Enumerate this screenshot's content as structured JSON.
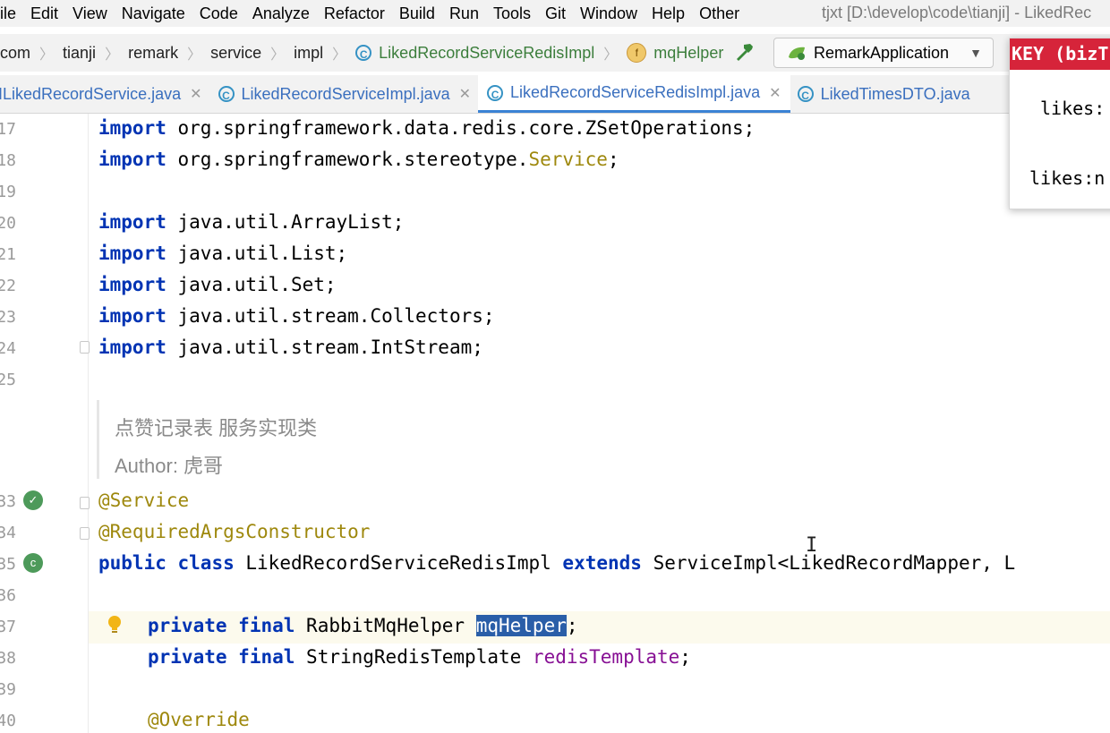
{
  "menu": {
    "items": [
      "ile",
      "Edit",
      "View",
      "Navigate",
      "Code",
      "Analyze",
      "Refactor",
      "Build",
      "Run",
      "Tools",
      "Git",
      "Window",
      "Help",
      "Other"
    ],
    "window_title": "tjxt [D:\\develop\\code\\tianji] - LikedRec"
  },
  "navbar": {
    "crumbs": [
      "com",
      "tianji",
      "remark",
      "service",
      "impl"
    ],
    "class_crumb": "LikedRecordServiceRedisImpl",
    "field_crumb": "mqHelper",
    "run_config": "RemarkApplication"
  },
  "tabs": [
    {
      "label": "ILikedRecordService.java",
      "closable": true,
      "active": false
    },
    {
      "label": "LikedRecordServiceImpl.java",
      "closable": true,
      "active": false
    },
    {
      "label": "LikedRecordServiceRedisImpl.java",
      "closable": true,
      "active": true
    },
    {
      "label": "LikedTimesDTO.java",
      "closable": false,
      "active": false
    }
  ],
  "editor": {
    "line_numbers": [
      "17",
      "18",
      "19",
      "20",
      "21",
      "22",
      "23",
      "24",
      "25",
      "33",
      "34",
      "35",
      "36",
      "37",
      "38",
      "39",
      "40"
    ],
    "imports": [
      "org.springframework.data.redis.core.ZSetOperations;",
      "org.springframework.stereotype.",
      "java.util.ArrayList;",
      "java.util.List;",
      "java.util.Set;",
      "java.util.stream.Collectors;",
      "java.util.stream.IntStream;"
    ],
    "import_kw": "import",
    "service_word": "Service",
    "doc_line1": "点赞记录表 服务实现类",
    "doc_line2": "Author: 虎哥",
    "annotation1": "@Service",
    "annotation2": "@RequiredArgsConstructor",
    "class_decl": {
      "kw_public": "public",
      "kw_class": "class",
      "name": "LikedRecordServiceRedisImpl",
      "kw_extends": "extends",
      "rest": "ServiceImpl<LikedRecordMapper, L"
    },
    "field1": {
      "kw1": "private",
      "kw2": "final",
      "type": "RabbitMqHelper",
      "name": "mqHelper"
    },
    "field2": {
      "kw1": "private",
      "kw2": "final",
      "type": "StringRedisTemplate",
      "name": "redisTemplate"
    },
    "override": "@Override",
    "semicolon": ";"
  },
  "popup": {
    "header": "KEY (bizT",
    "row1": "likes:",
    "row2": "likes:n"
  }
}
